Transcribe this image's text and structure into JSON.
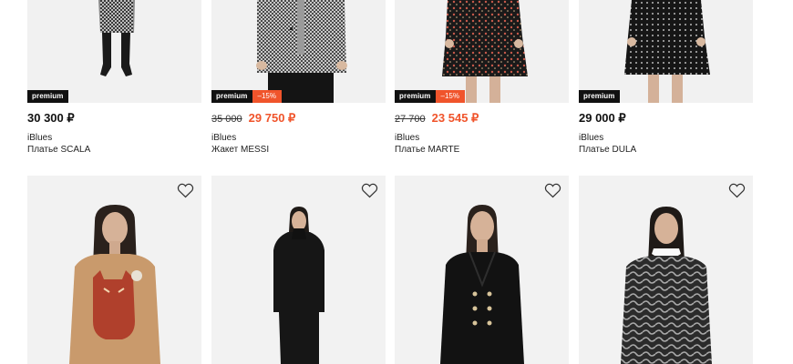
{
  "products_top": [
    {
      "badge": "premium",
      "discount": "",
      "old_price": "",
      "price": "30 300 ₽",
      "brand": "iBlues",
      "title": "Платье SCALA"
    },
    {
      "badge": "premium",
      "discount": "–15%",
      "old_price": "35 000",
      "price": "29 750 ₽",
      "brand": "iBlues",
      "title": "Жакет MESSI"
    },
    {
      "badge": "premium",
      "discount": "–15%",
      "old_price": "27 700",
      "price": "23 545 ₽",
      "brand": "iBlues",
      "title": "Платье MARTE"
    },
    {
      "badge": "premium",
      "discount": "",
      "old_price": "",
      "price": "29 000 ₽",
      "brand": "iBlues",
      "title": "Платье DULA"
    }
  ],
  "products_bottom": [
    {
      "favorite_icon": "heart-outline-icon"
    },
    {
      "favorite_icon": "heart-outline-icon"
    },
    {
      "favorite_icon": "heart-outline-icon"
    },
    {
      "favorite_icon": "heart-outline-icon"
    }
  ],
  "colors": {
    "sale": "#f0542b",
    "badge_bg": "#111111",
    "image_bg": "#f1f1f1"
  }
}
